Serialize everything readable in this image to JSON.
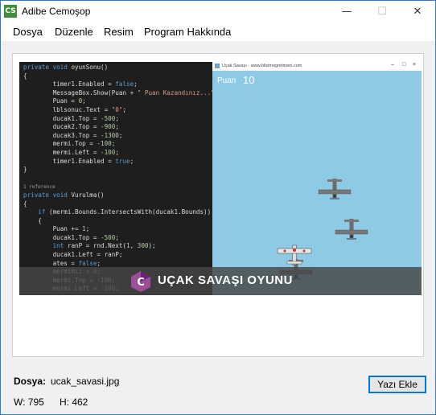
{
  "window": {
    "title": "Adibe Cemoşop",
    "icon_label": "CS",
    "controls": {
      "minimize": "—",
      "maximize": "☐",
      "close": "✕"
    }
  },
  "menu": [
    "Dosya",
    "Düzenle",
    "Resim",
    "Program Hakkında"
  ],
  "image": {
    "code_lines": [
      [
        {
          "t": "private void ",
          "c": "kw"
        },
        {
          "t": "oyunSonu()",
          "c": ""
        }
      ],
      [
        {
          "t": "{",
          "c": ""
        }
      ],
      [
        {
          "t": "        timer1.Enabled = ",
          "c": ""
        },
        {
          "t": "false",
          "c": "kw"
        },
        {
          "t": ";",
          "c": ""
        }
      ],
      [
        {
          "t": "        MessageBox.Show(Puan + ",
          "c": ""
        },
        {
          "t": "\" Puan Kazandınız...\"",
          "c": "str"
        },
        {
          "t": ");",
          "c": ""
        }
      ],
      [
        {
          "t": "        Puan = ",
          "c": ""
        },
        {
          "t": "0",
          "c": "num"
        },
        {
          "t": ";",
          "c": ""
        }
      ],
      [
        {
          "t": "        lblsonuc.Text = ",
          "c": ""
        },
        {
          "t": "\"0\"",
          "c": "str"
        },
        {
          "t": ";",
          "c": ""
        }
      ],
      [
        {
          "t": "        ducak1.Top = ",
          "c": ""
        },
        {
          "t": "-500",
          "c": "num"
        },
        {
          "t": ";",
          "c": ""
        }
      ],
      [
        {
          "t": "        ducak2.Top = ",
          "c": ""
        },
        {
          "t": "-900",
          "c": "num"
        },
        {
          "t": ";",
          "c": ""
        }
      ],
      [
        {
          "t": "        ducak3.Top = ",
          "c": ""
        },
        {
          "t": "-1300",
          "c": "num"
        },
        {
          "t": ";",
          "c": ""
        }
      ],
      [
        {
          "t": "        mermi.Top = ",
          "c": ""
        },
        {
          "t": "-100",
          "c": "num"
        },
        {
          "t": ";",
          "c": ""
        }
      ],
      [
        {
          "t": "        mermi.Left = ",
          "c": ""
        },
        {
          "t": "-100",
          "c": "num"
        },
        {
          "t": ";",
          "c": ""
        }
      ],
      [
        {
          "t": "        timer1.Enabled = ",
          "c": ""
        },
        {
          "t": "true",
          "c": "kw"
        },
        {
          "t": ";",
          "c": ""
        }
      ],
      [
        {
          "t": "}",
          "c": ""
        }
      ],
      [
        {
          "t": "",
          "c": ""
        }
      ],
      [
        {
          "t": "1 reference",
          "c": "ref"
        }
      ],
      [
        {
          "t": "private void ",
          "c": "kw"
        },
        {
          "t": "Vurulma()",
          "c": ""
        }
      ],
      [
        {
          "t": "{",
          "c": ""
        }
      ],
      [
        {
          "t": "    ",
          "c": ""
        },
        {
          "t": "if",
          "c": "kw"
        },
        {
          "t": " (mermi.Bounds.IntersectsWith(ducak1.Bounds))",
          "c": ""
        }
      ],
      [
        {
          "t": "    {",
          "c": ""
        }
      ],
      [
        {
          "t": "        Puan += ",
          "c": ""
        },
        {
          "t": "1",
          "c": "num"
        },
        {
          "t": ";",
          "c": ""
        }
      ],
      [
        {
          "t": "        ducak1.Top = ",
          "c": ""
        },
        {
          "t": "-500",
          "c": "num"
        },
        {
          "t": ";",
          "c": ""
        }
      ],
      [
        {
          "t": "        ",
          "c": ""
        },
        {
          "t": "int",
          "c": "kw"
        },
        {
          "t": " ranP = rnd.Next(",
          "c": ""
        },
        {
          "t": "1",
          "c": "num"
        },
        {
          "t": ", ",
          "c": ""
        },
        {
          "t": "300",
          "c": "num"
        },
        {
          "t": ");",
          "c": ""
        }
      ],
      [
        {
          "t": "        ducak1.Left = ranP;",
          "c": ""
        }
      ],
      [
        {
          "t": "        ates = ",
          "c": ""
        },
        {
          "t": "false",
          "c": "kw"
        },
        {
          "t": ";",
          "c": ""
        }
      ],
      [
        {
          "t": "        mermiHız = ",
          "c": ""
        },
        {
          "t": "0",
          "c": "num"
        },
        {
          "t": ";",
          "c": ""
        }
      ],
      [
        {
          "t": "        mermi.Top = ",
          "c": ""
        },
        {
          "t": "-100",
          "c": "num"
        },
        {
          "t": ";",
          "c": ""
        }
      ],
      [
        {
          "t": "        mermi.Left = ",
          "c": ""
        },
        {
          "t": "-100",
          "c": "num"
        },
        {
          "t": ";",
          "c": ""
        }
      ]
    ],
    "game_window_title": "Uçak Savaşı - www.bilsimogretmeni.com",
    "score_label": "Puan",
    "score_value": "10",
    "banner_text": "UÇAK SAVAŞI OYUNU",
    "banner_logo_letter": "C",
    "sky_color": "#8ecae6"
  },
  "file": {
    "label": "Dosya:",
    "name": "ucak_savasi.jpg",
    "width": "W: 795",
    "height": "H: 462"
  },
  "buttons": {
    "add_text": "Yazı Ekle"
  }
}
